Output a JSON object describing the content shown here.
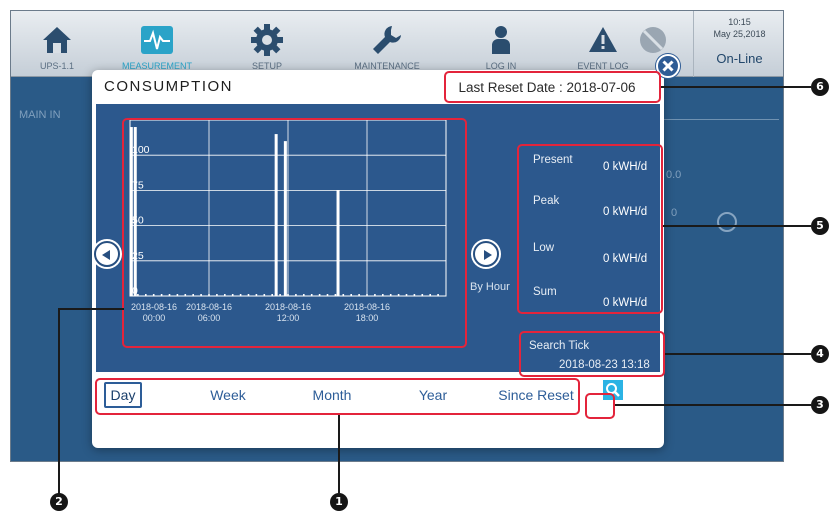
{
  "topbar": {
    "items": [
      {
        "label": "UPS-1.1",
        "icon": "home-icon"
      },
      {
        "label": "MEASUREMENT",
        "icon": "waveform-icon",
        "active": true
      },
      {
        "label": "SETUP",
        "icon": "gear-icon"
      },
      {
        "label": "MAINTENANCE",
        "icon": "wrench-icon"
      },
      {
        "label": "LOG IN",
        "icon": "user-icon"
      },
      {
        "label": "EVENT LOG",
        "icon": "warning-icon"
      },
      {
        "label": "",
        "icon": "mute-icon"
      }
    ],
    "clock": {
      "time": "10:15",
      "date": "May 25,2018",
      "status": "On-Line"
    }
  },
  "background": {
    "section_label": "MAIN IN",
    "value_1": "0.0",
    "value_2": "0"
  },
  "dialog": {
    "title": "CONSUMPTION",
    "last_reset": "Last Reset Date : 2018-07-06",
    "by_hour": "By Hour",
    "metrics": [
      {
        "label": "Present",
        "value": "0  kWH/d"
      },
      {
        "label": "Peak",
        "value": "0  kWH/d"
      },
      {
        "label": "Low",
        "value": "0  kWH/d"
      },
      {
        "label": "Sum",
        "value": "0  kWH/d"
      }
    ],
    "search_tick": {
      "label": "Search Tick",
      "value": "2018-08-23 13:18"
    },
    "tabs": [
      {
        "label": "Day",
        "active": true
      },
      {
        "label": "Week"
      },
      {
        "label": "Month"
      },
      {
        "label": "Year"
      },
      {
        "label": "Since Reset"
      }
    ]
  },
  "chart_data": {
    "type": "bar",
    "ylim": [
      0,
      125
    ],
    "yticks": [
      0,
      25,
      50,
      75,
      100
    ],
    "xticks": [
      {
        "hour": 0,
        "date": "2018-08-16",
        "time": "00:00"
      },
      {
        "hour": 6,
        "date": "2018-08-16",
        "time": "06:00"
      },
      {
        "hour": 12,
        "date": "2018-08-16",
        "time": "12:00"
      },
      {
        "hour": 18,
        "date": "2018-08-16",
        "time": "18:00"
      }
    ],
    "bars": [
      {
        "hour": 0.1,
        "value": 120
      },
      {
        "hour": 0.4,
        "value": 120
      },
      {
        "hour": 11.1,
        "value": 115
      },
      {
        "hour": 11.8,
        "value": 110
      },
      {
        "hour": 15.8,
        "value": 75
      }
    ]
  },
  "callouts": [
    "1",
    "2",
    "3",
    "4",
    "5",
    "6"
  ],
  "colors": {
    "accent": "#2c588d",
    "callout": "#e3243b",
    "search": "#2bb3e4"
  }
}
